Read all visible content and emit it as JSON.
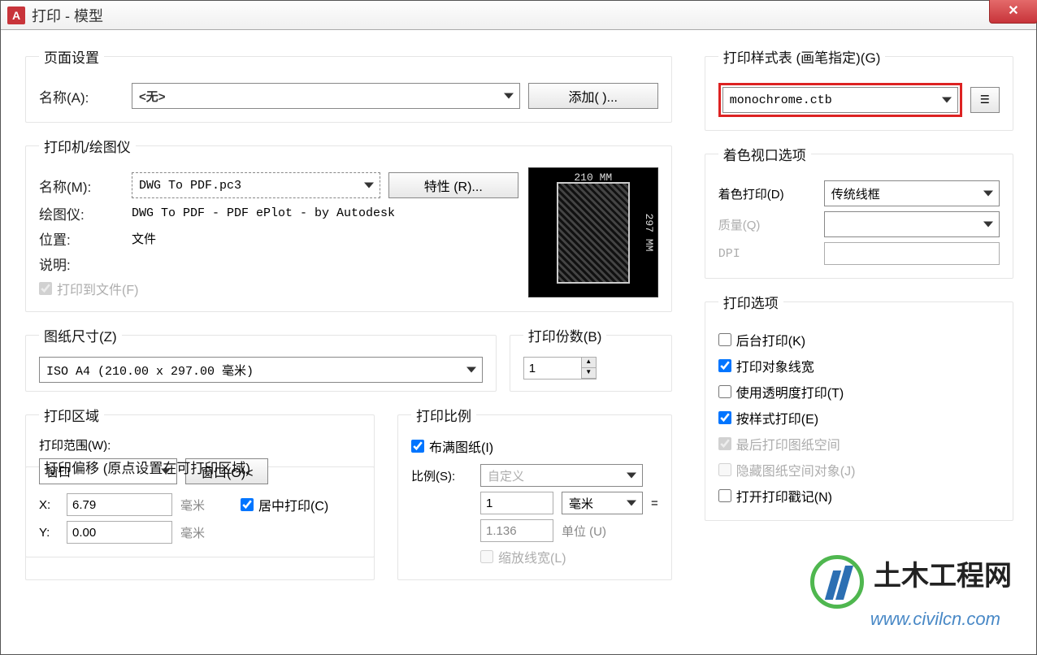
{
  "titlebar": {
    "title": "打印 - 模型",
    "app_icon_letter": "A",
    "close_x": "✕"
  },
  "page_setup": {
    "legend": "页面设置",
    "name_label": "名称(A):",
    "name_value": "<无>",
    "add_button": "添加( )..."
  },
  "printer": {
    "legend": "打印机/绘图仪",
    "name_label": "名称(M):",
    "name_value": "DWG To PDF.pc3",
    "props_button": "特性 (R)...",
    "plotter_label": "绘图仪:",
    "plotter_value": "DWG To PDF - PDF ePlot - by Autodesk",
    "location_label": "位置:",
    "location_value": "文件",
    "desc_label": "说明:",
    "file_checkbox": "打印到文件(F)",
    "preview_width": "210 MM",
    "preview_height": "297 MM"
  },
  "paper": {
    "legend": "图纸尺寸(Z)",
    "value": "ISO A4 (210.00 x 297.00 毫米)"
  },
  "copies": {
    "legend": "打印份数(B)",
    "value": "1"
  },
  "area": {
    "legend": "打印区域",
    "range_label": "打印范围(W):",
    "range_value": "窗口",
    "window_button": "窗口(O)<"
  },
  "offset": {
    "legend": "打印偏移  (原点设置在可打印区域)",
    "x_label": "X:",
    "x_value": "6.79",
    "x_unit": "毫米",
    "y_label": "Y:",
    "y_value": "0.00",
    "y_unit": "毫米",
    "center_checkbox": "居中打印(C)"
  },
  "scale": {
    "legend": "打印比例",
    "fit_checkbox": "布满图纸(I)",
    "scale_label": "比例(S):",
    "scale_value": "自定义",
    "num1": "1",
    "unit1": "毫米",
    "eq": "=",
    "num2": "1.136",
    "unit2": "单位 (U)",
    "scale_lw_checkbox": "缩放线宽(L)"
  },
  "plot_style": {
    "legend": "打印样式表 (画笔指定)(G)",
    "value": "monochrome.ctb"
  },
  "shaded": {
    "legend": "着色视口选项",
    "shade_label": "着色打印(D)",
    "shade_value": "传统线框",
    "quality_label": "质量(Q)",
    "dpi_label": "DPI"
  },
  "options": {
    "legend": "打印选项",
    "items": [
      {
        "label": "后台打印(K)",
        "checked": false,
        "enabled": true
      },
      {
        "label": "打印对象线宽",
        "checked": true,
        "enabled": true
      },
      {
        "label": "使用透明度打印(T)",
        "checked": false,
        "enabled": true
      },
      {
        "label": "按样式打印(E)",
        "checked": true,
        "enabled": true
      },
      {
        "label": "最后打印图纸空间",
        "checked": true,
        "enabled": false
      },
      {
        "label": "隐藏图纸空间对象(J)",
        "checked": false,
        "enabled": false
      },
      {
        "label": "打开打印戳记(N)",
        "checked": false,
        "enabled": true
      }
    ]
  },
  "watermark": {
    "title": "土木工程网",
    "url": "www.civilcn.com"
  }
}
